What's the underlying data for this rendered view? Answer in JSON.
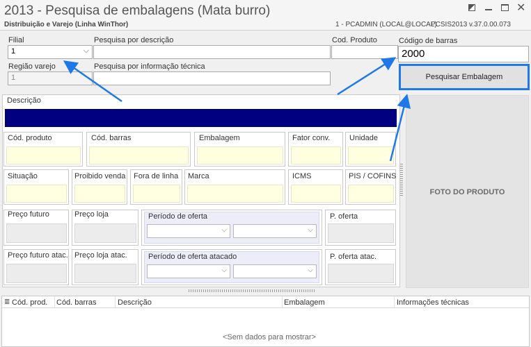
{
  "window": {
    "title": "2013 - Pesquisa de embalagens (Mata burro)",
    "subtitle": "Distribuição e Varejo (Linha WinThor)",
    "user_info": "1 - PCADMIN (LOCAL@LOCAL)",
    "version": "PCSIS2013  v.37.0.00.073"
  },
  "filters": {
    "filial_label": "Filial",
    "filial_value": "1",
    "regiao_label": "Região varejo",
    "regiao_value": "1",
    "pesq_desc_label": "Pesquisa por descrição",
    "pesq_info_label": "Pesquisa por informação técnica",
    "cod_produto_label": "Cod. Produto",
    "cod_barras_label": "Código de barras",
    "cod_barras_value": "2000",
    "search_button": "Pesquisar Embalagem"
  },
  "detail": {
    "descricao": "Descrição",
    "cod_produto": "Cód. produto",
    "cod_barras": "Cód. barras",
    "embalagem": "Embalagem",
    "fator_conv": "Fator conv.",
    "unidade": "Unidade",
    "situacao": "Situação",
    "proibido_venda": "Proibido venda",
    "fora_de_linha": "Fora de linha",
    "marca": "Marca",
    "icms": "ICMS",
    "pis_cofins": "PIS / COFINS",
    "preco_futuro": "Preço futuro",
    "preco_loja": "Preço loja",
    "periodo_oferta": "Período de oferta",
    "p_oferta": "P. oferta",
    "preco_futuro_atac": "Preço futuro atac.",
    "preco_loja_atac": "Preço loja atac.",
    "periodo_oferta_atac": "Período de oferta atacado",
    "p_oferta_atac": "P. oferta atac."
  },
  "photo": {
    "label": "FOTO DO PRODUTO"
  },
  "grid": {
    "columns": [
      "Cód. prod.",
      "Cód. barras",
      "Descrição",
      "Embalagem",
      "Informações técnicas"
    ],
    "empty": "<Sem dados para mostrar>"
  },
  "colors": {
    "accent": "#1e78e8",
    "desc_bar": "#000080",
    "yellow_field": "#ffffe1"
  }
}
